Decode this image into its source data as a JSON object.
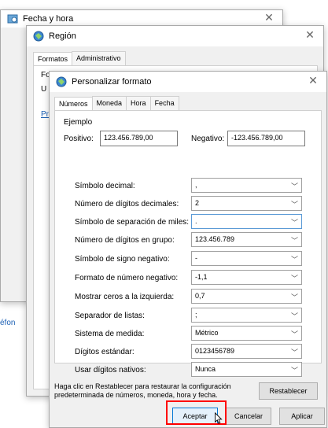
{
  "window_fecha": {
    "title": "Fecha y hora",
    "side_fragment": "éfon"
  },
  "window_region": {
    "title": "Región",
    "tabs": [
      "Formatos",
      "Administrativo"
    ],
    "fragment_fo": "Fo",
    "fragment_u": "U",
    "fragment_pr": "Pr"
  },
  "dialog": {
    "title": "Personalizar formato",
    "tabs": [
      "Números",
      "Moneda",
      "Hora",
      "Fecha"
    ],
    "example": {
      "label": "Ejemplo",
      "positive_label": "Positivo:",
      "positive_value": "123.456.789,00",
      "negative_label": "Negativo:",
      "negative_value": "-123.456.789,00"
    },
    "settings": [
      {
        "label": "Símbolo decimal:",
        "value": ","
      },
      {
        "label": "Número de dígitos decimales:",
        "value": "2"
      },
      {
        "label": "Símbolo de separación de miles:",
        "value": "."
      },
      {
        "label": "Número de dígitos en grupo:",
        "value": "123.456.789"
      },
      {
        "label": "Símbolo de signo negativo:",
        "value": "-"
      },
      {
        "label": "Formato de número negativo:",
        "value": "-1,1"
      },
      {
        "label": "Mostrar ceros a la izquierda:",
        "value": "0,7"
      },
      {
        "label": "Separador de listas:",
        "value": ";"
      },
      {
        "label": "Sistema de medida:",
        "value": "Métrico"
      },
      {
        "label": "Dígitos estándar:",
        "value": "0123456789"
      },
      {
        "label": "Usar dígitos nativos:",
        "value": "Nunca"
      }
    ],
    "reset_note": "Haga clic en Restablecer para restaurar la configuración predeterminada de números, moneda, hora y fecha.",
    "reset_button": "Restablecer",
    "ok_button": "Aceptar",
    "cancel_button": "Cancelar",
    "apply_button": "Aplicar"
  },
  "colors": {
    "highlight_box": "#ff0000",
    "focus_border": "#0078d7"
  }
}
